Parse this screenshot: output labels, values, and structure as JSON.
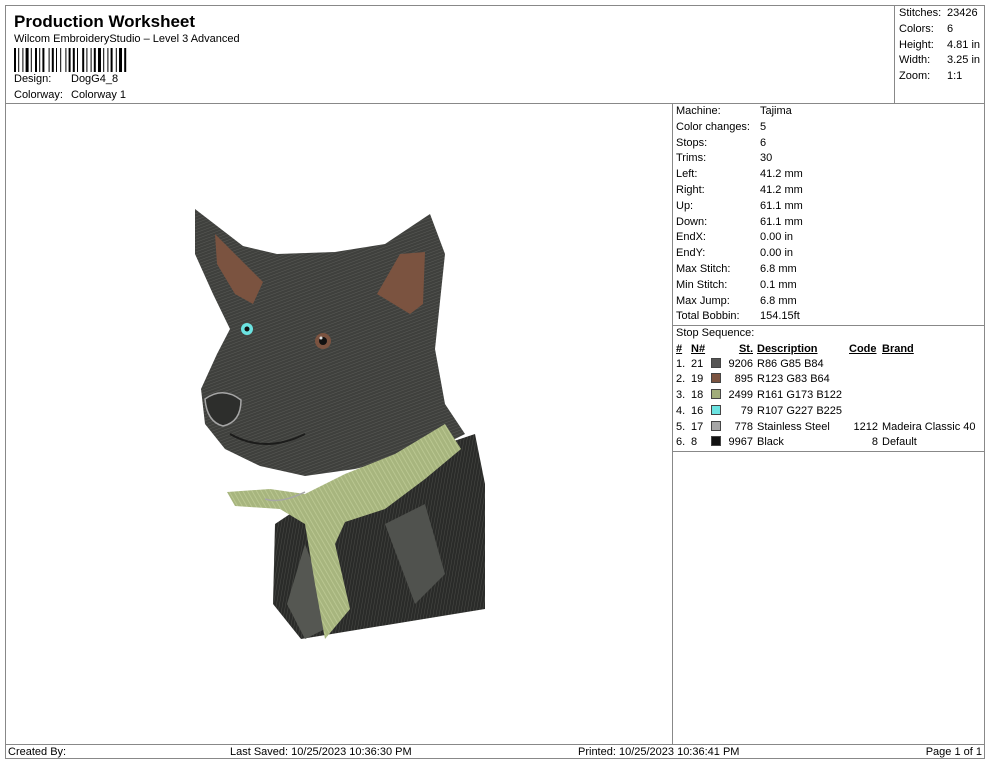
{
  "header": {
    "title": "Production Worksheet",
    "software": "Wilcom EmbroideryStudio – Level 3 Advanced",
    "design_label": "Design:",
    "design_value": "DogG4_8",
    "colorway_label": "Colorway:",
    "colorway_value": "Colorway 1"
  },
  "summary": {
    "stitches_label": "Stitches:",
    "stitches": "23426",
    "colors_label": "Colors:",
    "colors": "6",
    "height_label": "Height:",
    "height": "4.81 in",
    "width_label": "Width:",
    "width": "3.25 in",
    "zoom_label": "Zoom:",
    "zoom": "1:1"
  },
  "machine_info": [
    {
      "label": "Machine:",
      "value": "Tajima"
    },
    {
      "label": "Color changes:",
      "value": "5"
    },
    {
      "label": "Stops:",
      "value": "6"
    },
    {
      "label": "Trims:",
      "value": "30"
    },
    {
      "label": "Left:",
      "value": "41.2 mm"
    },
    {
      "label": "Right:",
      "value": "41.2 mm"
    },
    {
      "label": "Up:",
      "value": "61.1 mm"
    },
    {
      "label": "Down:",
      "value": "61.1 mm"
    },
    {
      "label": "EndX:",
      "value": "0.00 in"
    },
    {
      "label": "EndY:",
      "value": "0.00 in"
    },
    {
      "label": "Max Stitch:",
      "value": "6.8 mm"
    },
    {
      "label": "Min Stitch:",
      "value": "0.1 mm"
    },
    {
      "label": "Max Jump:",
      "value": "6.8 mm"
    },
    {
      "label": "Total Bobbin:",
      "value": "154.15ft"
    }
  ],
  "stop_sequence": {
    "caption": "Stop Sequence:",
    "headers": {
      "num": "#",
      "n": "N#",
      "st": "St.",
      "desc": "Description",
      "code": "Code",
      "brand": "Brand"
    },
    "rows": [
      {
        "num": "1.",
        "n": "21",
        "color": "#565554",
        "st": "9206",
        "desc": "R86 G85 B84",
        "code": "",
        "brand": ""
      },
      {
        "num": "2.",
        "n": "19",
        "color": "#7B5340",
        "st": "895",
        "desc": "R123 G83 B64",
        "code": "",
        "brand": ""
      },
      {
        "num": "3.",
        "n": "18",
        "color": "#A1AD7A",
        "st": "2499",
        "desc": "R161 G173 B122",
        "code": "",
        "brand": ""
      },
      {
        "num": "4.",
        "n": "16",
        "color": "#6BE3E1",
        "st": "79",
        "desc": "R107 G227 B225",
        "code": "",
        "brand": ""
      },
      {
        "num": "5.",
        "n": "17",
        "color": "#A6A6A6",
        "st": "778",
        "desc": "Stainless Steel",
        "code": "1212",
        "brand": "Madeira Classic 40"
      },
      {
        "num": "6.",
        "n": "8",
        "color": "#111111",
        "st": "9967",
        "desc": "Black",
        "code": "8",
        "brand": "Default"
      }
    ]
  },
  "footer": {
    "created_by": "Created By:",
    "last_saved": "Last Saved: 10/25/2023 10:36:30 PM",
    "printed": "Printed: 10/25/2023 10:36:41 PM",
    "page": "Page 1 of 1"
  }
}
